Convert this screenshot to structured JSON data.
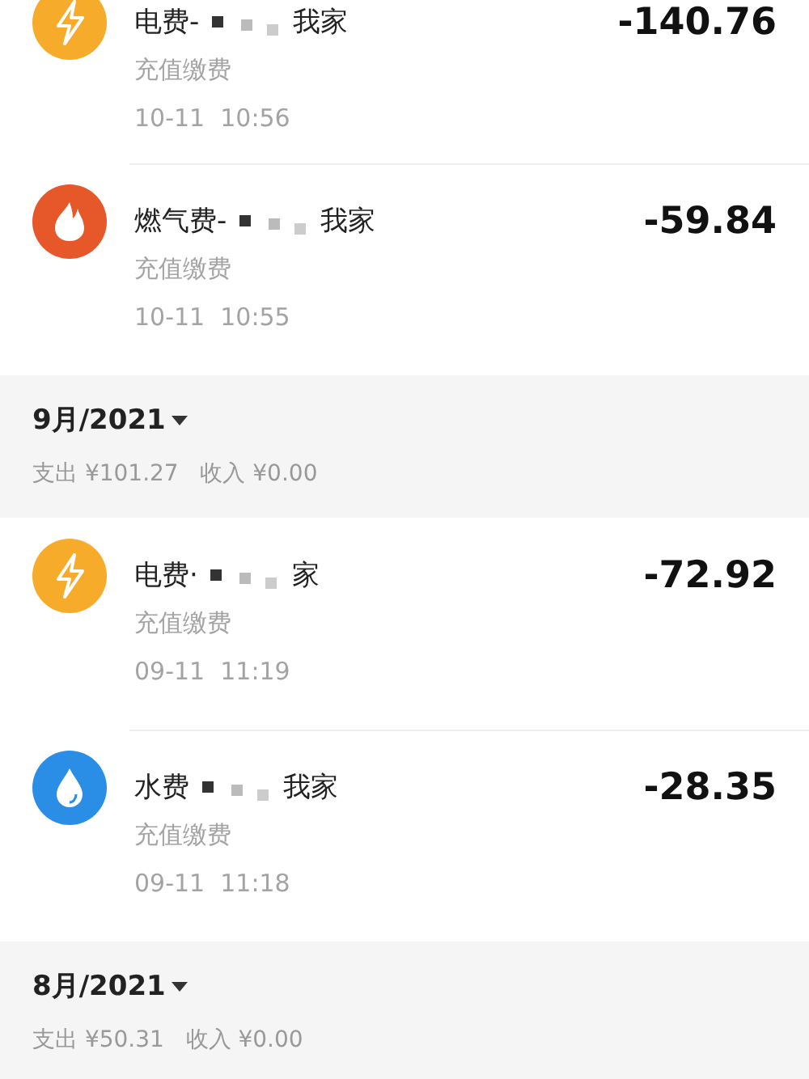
{
  "groups": [
    {
      "records": [
        {
          "kind": "electric",
          "title_start": "电费-",
          "title_end": "我家",
          "category": "充值缴费",
          "time": "10-11  10:56",
          "amount": "-140.76"
        },
        {
          "kind": "gas",
          "title_start": "燃气费-",
          "title_end": "我家",
          "category": "充值缴费",
          "time": "10-11  10:55",
          "amount": "-59.84"
        }
      ]
    },
    {
      "month": "9月/2021",
      "summary": "支出 ¥101.27   收入 ¥0.00",
      "records": [
        {
          "kind": "electric",
          "title_start": "电费·",
          "title_end": "家",
          "category": "充值缴费",
          "time": "09-11  11:19",
          "amount": "-72.92"
        },
        {
          "kind": "water",
          "title_start": "水费",
          "title_end": "我家",
          "category": "充值缴费",
          "time": "09-11  11:18",
          "amount": "-28.35"
        }
      ]
    },
    {
      "month": "8月/2021",
      "summary": "支出 ¥50.31   收入 ¥0.00"
    }
  ]
}
